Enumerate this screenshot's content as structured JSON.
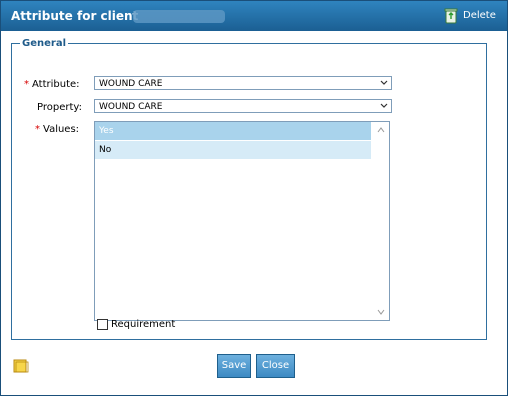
{
  "titlebar": {
    "title": "Attribute for client",
    "delete_label": "Delete"
  },
  "general": {
    "legend": "General",
    "attribute_label": "Attribute:",
    "attribute_value": "WOUND CARE",
    "property_label": "Property:",
    "property_value": "WOUND CARE",
    "values_label": "Values:",
    "values_options": [
      "Yes",
      "No"
    ],
    "requirement_label": "Requirement"
  },
  "buttons": {
    "save": "Save",
    "close": "Close"
  },
  "colors": {
    "titlebar": "#1b5f93",
    "accent": "#3d8ac3",
    "required": "#d60000"
  }
}
